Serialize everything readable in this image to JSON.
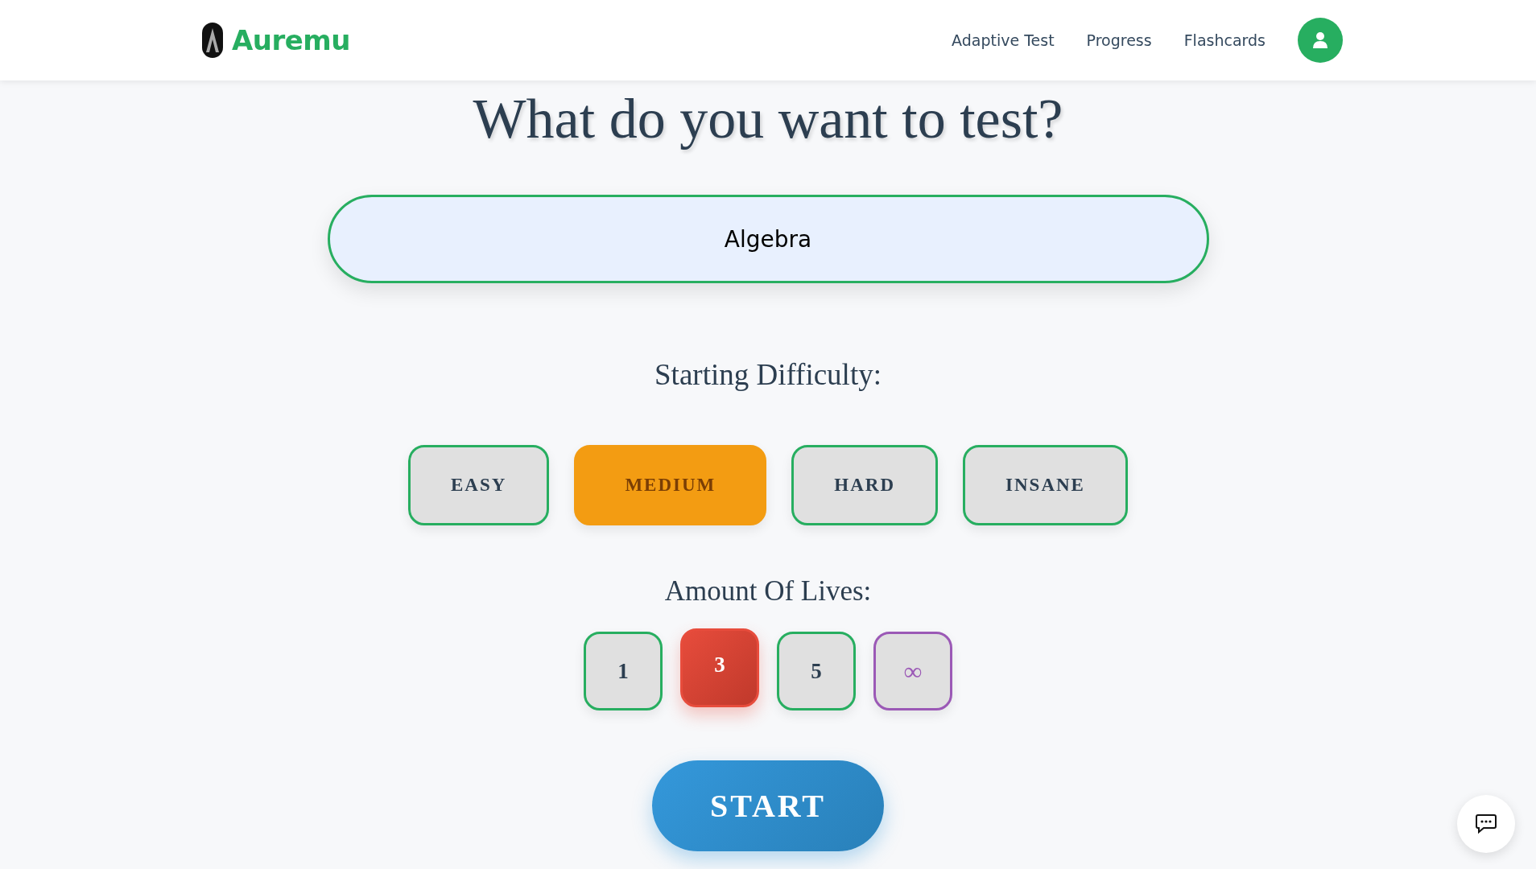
{
  "header": {
    "brand": "Auremu",
    "nav": [
      {
        "label": "Adaptive Test"
      },
      {
        "label": "Progress"
      },
      {
        "label": "Flashcards"
      }
    ]
  },
  "title": "What do you want to test?",
  "topic_field": {
    "value": "Algebra"
  },
  "difficulty": {
    "label": "Starting Difficulty:",
    "options": [
      {
        "label": "EASY",
        "selected": false
      },
      {
        "label": "MEDIUM",
        "selected": true
      },
      {
        "label": "HARD",
        "selected": false
      },
      {
        "label": "INSANE",
        "selected": false
      }
    ]
  },
  "lives": {
    "label": "Amount Of Lives:",
    "options": [
      {
        "label": "1",
        "kind": "number",
        "selected": false
      },
      {
        "label": "3",
        "kind": "number",
        "selected": true
      },
      {
        "label": "5",
        "kind": "number",
        "selected": false
      },
      {
        "label": "∞",
        "kind": "infinite",
        "selected": false
      }
    ]
  },
  "start_button": "START"
}
